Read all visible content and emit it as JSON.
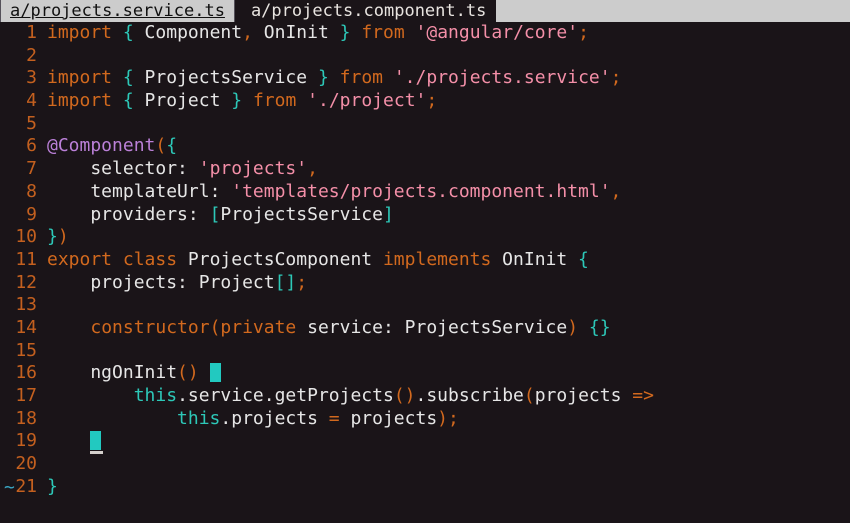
{
  "window": {
    "title": "vim terminal editor",
    "background_color": "#1a1418",
    "tabbar_background": "#cccccc"
  },
  "tabbar": {
    "tabs": [
      {
        "label": "a/projects.service.ts",
        "state": "active"
      },
      {
        "label": "a/projects.component.ts",
        "state": "inactive"
      }
    ]
  },
  "colors": {
    "keyword": "#d2691e",
    "brace": "#2dc8b8",
    "identifier": "#e6e6e6",
    "string": "#f48fa8",
    "decorator": "#bb80d8",
    "this_keyword": "#2dc8b8",
    "line_number": "#c4601f",
    "cursor": "#22c9c0",
    "tilde": "#3aa7c4",
    "background": "#1a1418"
  },
  "editor": {
    "filler_marker": "~",
    "lines": [
      {
        "num": "1",
        "tokens": [
          {
            "t": "import",
            "c": "kw"
          },
          {
            "t": " ",
            "c": "ident"
          },
          {
            "t": "{",
            "c": "brace"
          },
          {
            "t": " Component",
            "c": "ident"
          },
          {
            "t": ",",
            "c": "punct"
          },
          {
            "t": " OnInit ",
            "c": "ident"
          },
          {
            "t": "}",
            "c": "brace"
          },
          {
            "t": " ",
            "c": "ident"
          },
          {
            "t": "from",
            "c": "kw"
          },
          {
            "t": " ",
            "c": "ident"
          },
          {
            "t": "'@angular/core'",
            "c": "str"
          },
          {
            "t": ";",
            "c": "punct"
          }
        ]
      },
      {
        "num": "2",
        "tokens": []
      },
      {
        "num": "3",
        "tokens": [
          {
            "t": "import",
            "c": "kw"
          },
          {
            "t": " ",
            "c": "ident"
          },
          {
            "t": "{",
            "c": "brace"
          },
          {
            "t": " ProjectsService ",
            "c": "ident"
          },
          {
            "t": "}",
            "c": "brace"
          },
          {
            "t": " ",
            "c": "ident"
          },
          {
            "t": "from",
            "c": "kw"
          },
          {
            "t": " ",
            "c": "ident"
          },
          {
            "t": "'./projects.service'",
            "c": "str"
          },
          {
            "t": ";",
            "c": "punct"
          }
        ]
      },
      {
        "num": "4",
        "tokens": [
          {
            "t": "import",
            "c": "kw"
          },
          {
            "t": " ",
            "c": "ident"
          },
          {
            "t": "{",
            "c": "brace"
          },
          {
            "t": " Project ",
            "c": "ident"
          },
          {
            "t": "}",
            "c": "brace"
          },
          {
            "t": " ",
            "c": "ident"
          },
          {
            "t": "from",
            "c": "kw"
          },
          {
            "t": " ",
            "c": "ident"
          },
          {
            "t": "'./project'",
            "c": "str"
          },
          {
            "t": ";",
            "c": "punct"
          }
        ]
      },
      {
        "num": "5",
        "tokens": []
      },
      {
        "num": "6",
        "tokens": [
          {
            "t": "@Component",
            "c": "deco"
          },
          {
            "t": "(",
            "c": "punct"
          },
          {
            "t": "{",
            "c": "brace"
          }
        ]
      },
      {
        "num": "7",
        "tokens": [
          {
            "t": "    selector",
            "c": "ident"
          },
          {
            "t": ": ",
            "c": "ident"
          },
          {
            "t": "'projects'",
            "c": "str"
          },
          {
            "t": ",",
            "c": "punct"
          }
        ]
      },
      {
        "num": "8",
        "tokens": [
          {
            "t": "    templateUrl",
            "c": "ident"
          },
          {
            "t": ": ",
            "c": "ident"
          },
          {
            "t": "'templates/projects.component.html'",
            "c": "str"
          },
          {
            "t": ",",
            "c": "punct"
          }
        ]
      },
      {
        "num": "9",
        "tokens": [
          {
            "t": "    providers",
            "c": "ident"
          },
          {
            "t": ": ",
            "c": "ident"
          },
          {
            "t": "[",
            "c": "brace"
          },
          {
            "t": "ProjectsService",
            "c": "ident"
          },
          {
            "t": "]",
            "c": "brace"
          }
        ]
      },
      {
        "num": "10",
        "tokens": [
          {
            "t": "}",
            "c": "brace"
          },
          {
            "t": ")",
            "c": "punct"
          }
        ]
      },
      {
        "num": "11",
        "tokens": [
          {
            "t": "export",
            "c": "kw"
          },
          {
            "t": " ",
            "c": "ident"
          },
          {
            "t": "class",
            "c": "kw"
          },
          {
            "t": " ProjectsComponent ",
            "c": "ident"
          },
          {
            "t": "implements",
            "c": "kw"
          },
          {
            "t": " OnInit ",
            "c": "ident"
          },
          {
            "t": "{",
            "c": "brace"
          }
        ]
      },
      {
        "num": "12",
        "tokens": [
          {
            "t": "    projects",
            "c": "ident"
          },
          {
            "t": ": ",
            "c": "ident"
          },
          {
            "t": "Project",
            "c": "ident"
          },
          {
            "t": "[]",
            "c": "brace"
          },
          {
            "t": ";",
            "c": "punct"
          }
        ]
      },
      {
        "num": "13",
        "tokens": []
      },
      {
        "num": "14",
        "tokens": [
          {
            "t": "    ",
            "c": "ident"
          },
          {
            "t": "constructor(",
            "c": "kw"
          },
          {
            "t": "private",
            "c": "kw"
          },
          {
            "t": " service",
            "c": "ident"
          },
          {
            "t": ": ",
            "c": "ident"
          },
          {
            "t": "ProjectsService",
            "c": "ident"
          },
          {
            "t": ")",
            "c": "punct"
          },
          {
            "t": " ",
            "c": "ident"
          },
          {
            "t": "{}",
            "c": "brace"
          }
        ]
      },
      {
        "num": "15",
        "tokens": []
      },
      {
        "num": "16",
        "tokens": [
          {
            "t": "    ngOnInit",
            "c": "ident"
          },
          {
            "t": "()",
            "c": "punct"
          },
          {
            "t": " ",
            "c": "ident"
          }
        ],
        "cursor": "block"
      },
      {
        "num": "17",
        "tokens": [
          {
            "t": "        ",
            "c": "ident"
          },
          {
            "t": "this",
            "c": "this"
          },
          {
            "t": ".service.getProjects",
            "c": "ident"
          },
          {
            "t": "()",
            "c": "punct"
          },
          {
            "t": ".subscribe",
            "c": "ident"
          },
          {
            "t": "(",
            "c": "punct"
          },
          {
            "t": "projects ",
            "c": "ident"
          },
          {
            "t": "=>",
            "c": "punct"
          }
        ]
      },
      {
        "num": "18",
        "tokens": [
          {
            "t": "            ",
            "c": "ident"
          },
          {
            "t": "this",
            "c": "this"
          },
          {
            "t": ".projects ",
            "c": "ident"
          },
          {
            "t": "=",
            "c": "punct"
          },
          {
            "t": " projects",
            "c": "ident"
          },
          {
            "t": ");",
            "c": "punct"
          }
        ]
      },
      {
        "num": "19",
        "tokens": [
          {
            "t": "    ",
            "c": "ident"
          }
        ],
        "cursor": "block-underline"
      },
      {
        "num": "20",
        "tokens": []
      },
      {
        "num": "21",
        "tokens": [
          {
            "t": "}",
            "c": "brace"
          }
        ]
      }
    ]
  }
}
